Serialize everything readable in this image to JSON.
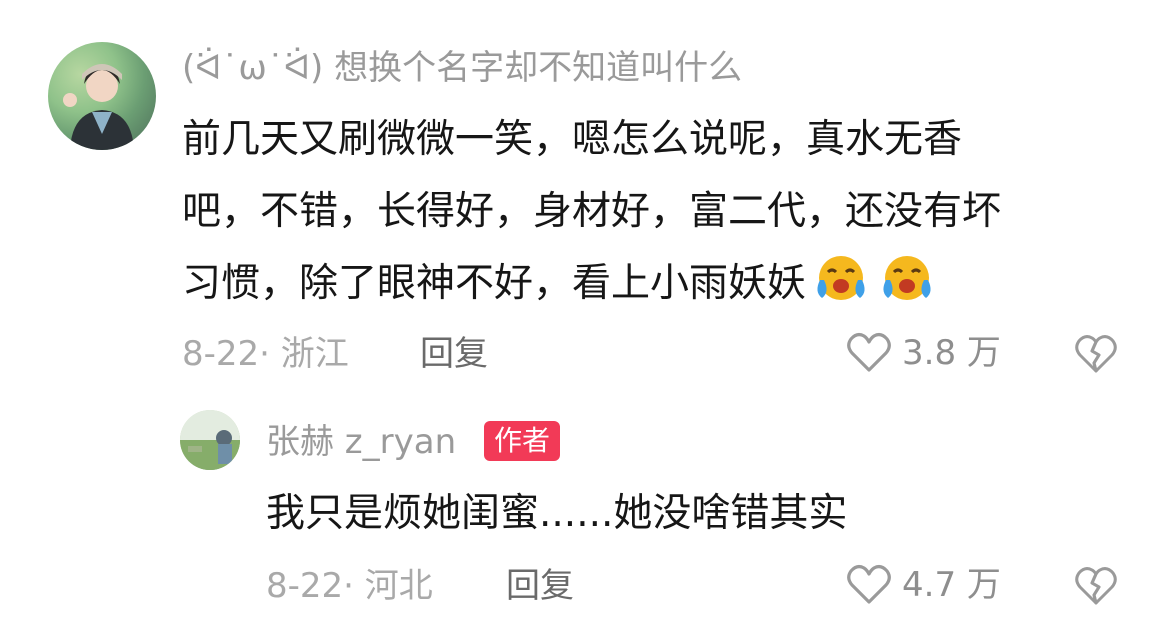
{
  "comment": {
    "username": "(ᐛ˙ω˙ᐛ) 想换个名字却不知道叫什么",
    "text_line1": "前几天又刷微微一笑，嗯怎么说呢，真水无香",
    "text_line2": "吧，不错，长得好，身材好，富二代，还没有坏",
    "text_line3": "习惯，除了眼神不好，看上小雨妖妖",
    "emoji": "crying-face-icon",
    "date_location": "8-22· 浙江",
    "reply_label": "回复",
    "likes": "3.8 万"
  },
  "reply": {
    "username": "张赫 z_ryan",
    "badge": "作者",
    "text": "我只是烦她闺蜜......她没啥错其实",
    "date_location": "8-22· 河北",
    "reply_label": "回复",
    "likes": "4.7 万"
  },
  "colors": {
    "badge": "#f23a57",
    "emoji_face": "#f5b81e",
    "emoji_tears": "#3fa0e8",
    "meta_text": "#a9a9a9"
  }
}
